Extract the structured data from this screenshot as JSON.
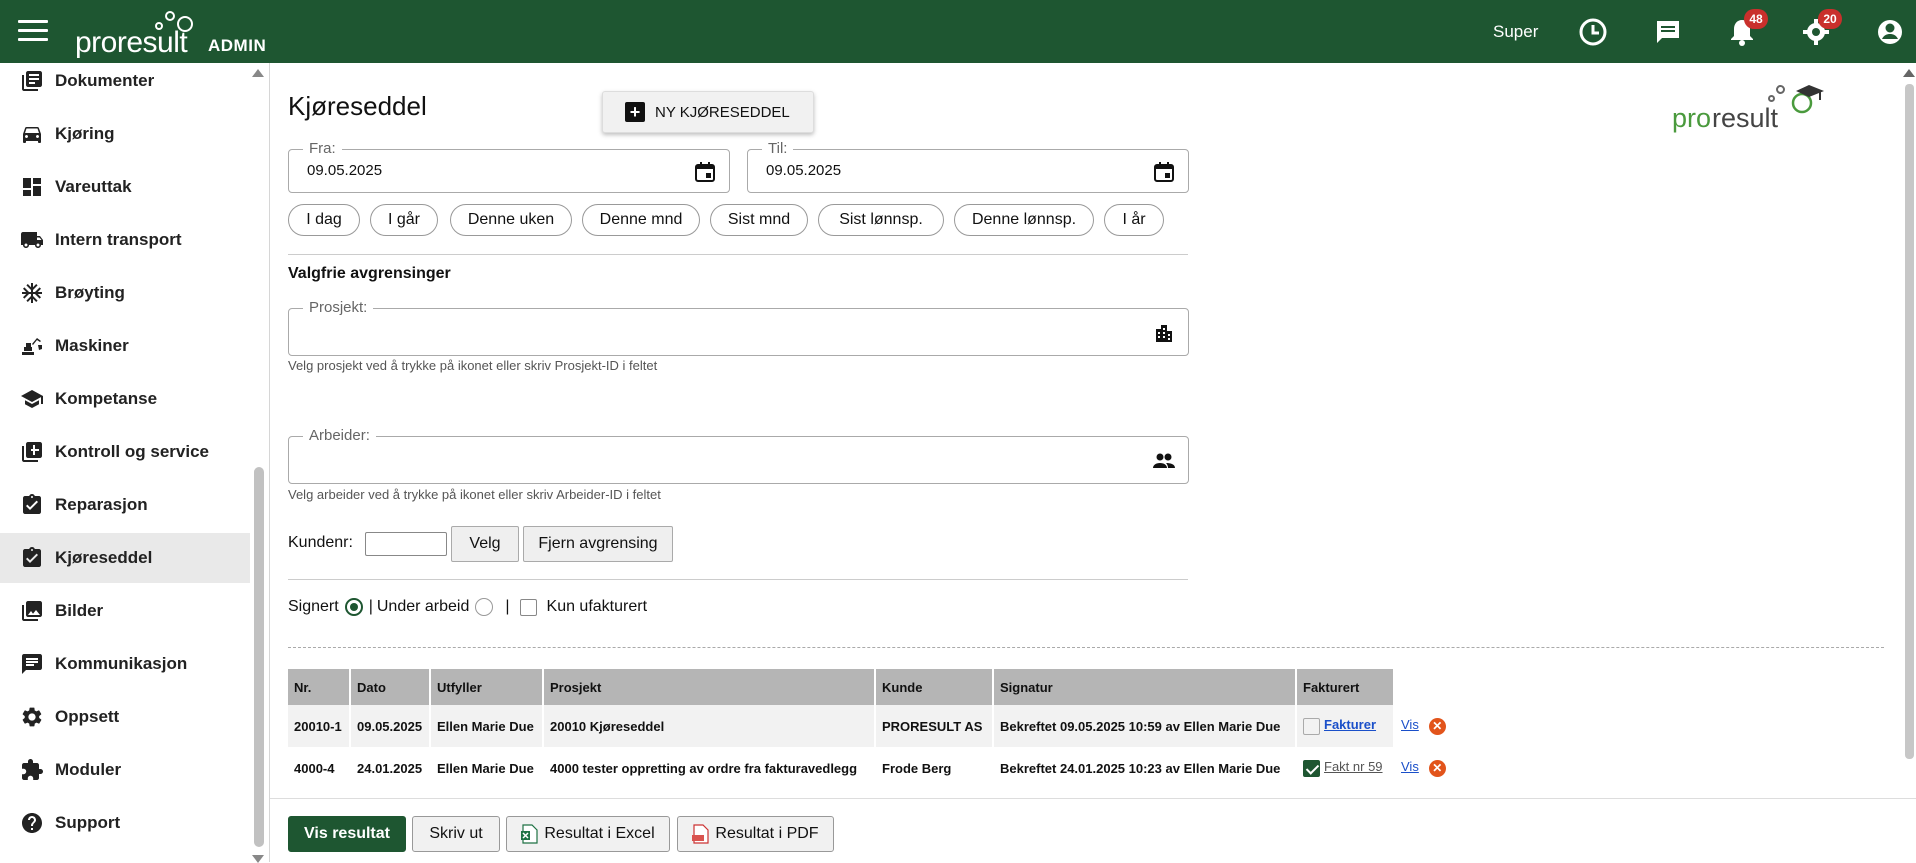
{
  "header": {
    "logo_word": "proresult",
    "logo_badge": "ADMIN",
    "user": "Super",
    "notifications_count": "48",
    "settings_count": "20"
  },
  "sidebar": {
    "items": [
      {
        "label": "Dokumenter",
        "icon": "documents-icon"
      },
      {
        "label": "Kjøring",
        "icon": "car-icon"
      },
      {
        "label": "Vareuttak",
        "icon": "dashboard-icon"
      },
      {
        "label": "Intern transport",
        "icon": "truck-icon"
      },
      {
        "label": "Brøyting",
        "icon": "snowflake-icon"
      },
      {
        "label": "Maskiner",
        "icon": "excavator-icon"
      },
      {
        "label": "Kompetanse",
        "icon": "graduation-cap-icon"
      },
      {
        "label": "Kontroll og service",
        "icon": "library-books-icon"
      },
      {
        "label": "Reparasjon",
        "icon": "clipboard-check-icon"
      },
      {
        "label": "Kjøreseddel",
        "icon": "clipboard-check-icon"
      },
      {
        "label": "Bilder",
        "icon": "photo-library-icon"
      },
      {
        "label": "Kommunikasjon",
        "icon": "chat-icon"
      },
      {
        "label": "Oppsett",
        "icon": "gear-icon"
      },
      {
        "label": "Moduler",
        "icon": "puzzle-icon"
      },
      {
        "label": "Support",
        "icon": "help-circle-icon"
      }
    ],
    "active_index": 9
  },
  "page": {
    "title": "Kjøreseddel",
    "new_button": "NY KJØRESEDDEL",
    "brand_word_a": "pro",
    "brand_word_b": "result"
  },
  "dates": {
    "from_label": "Fra:",
    "from_value": "09.05.2025",
    "to_label": "Til:",
    "to_value": "09.05.2025"
  },
  "quick_ranges": [
    "I dag",
    "I går",
    "Denne uken",
    "Denne mnd",
    "Sist mnd",
    "Sist lønnsp.",
    "Denne lønnsp.",
    "I år"
  ],
  "filters": {
    "section_title": "Valgfrie avgrensinger",
    "project_label": "Prosjekt:",
    "project_value": "",
    "project_help": "Velg prosjekt ved å trykke på ikonet eller skriv Prosjekt-ID i feltet",
    "worker_label": "Arbeider:",
    "worker_value": "",
    "worker_help": "Velg arbeider ved å trykke på ikonet eller skriv Arbeider-ID i feltet",
    "customer_label": "Kundenr:",
    "customer_value": "",
    "select_button": "Velg",
    "remove_button": "Fjern avgrensing",
    "signed_label": "Signert",
    "sep1": "|",
    "in_progress_label": "Under arbeid",
    "sep2": "|",
    "uninvoiced_label": "Kun ufakturert"
  },
  "table": {
    "headers": [
      "Nr.",
      "Dato",
      "Utfyller",
      "Prosjekt",
      "Kunde",
      "Signatur",
      "Fakturert"
    ],
    "rows": [
      {
        "nr": "20010-1",
        "date": "09.05.2025",
        "filler": "Ellen Marie Due",
        "project": "20010 Kjøreseddel",
        "customer": "PRORESULT AS",
        "signature": "Bekreftet 09.05.2025 10:59 av Ellen Marie Due",
        "invoiced": false,
        "invoice_text": "Fakturer",
        "view": "Vis"
      },
      {
        "nr": "4000-4",
        "date": "24.01.2025",
        "filler": "Ellen Marie Due",
        "project": "4000 tester oppretting av ordre fra fakturavedlegg",
        "customer": "Frode Berg",
        "signature": "Bekreftet 24.01.2025 10:23 av Ellen Marie Due",
        "invoiced": true,
        "invoice_text": "Fakt nr 59",
        "view": "Vis"
      }
    ]
  },
  "footer": {
    "show_result": "Vis resultat",
    "print": "Skriv ut",
    "excel": "Resultat i Excel",
    "pdf": "Resultat i PDF"
  },
  "colors": {
    "brand_green": "#1e5631",
    "badge_red": "#c9302c",
    "delete_orange": "#e2541b",
    "brand_logo_green": "#4a9a3d"
  }
}
